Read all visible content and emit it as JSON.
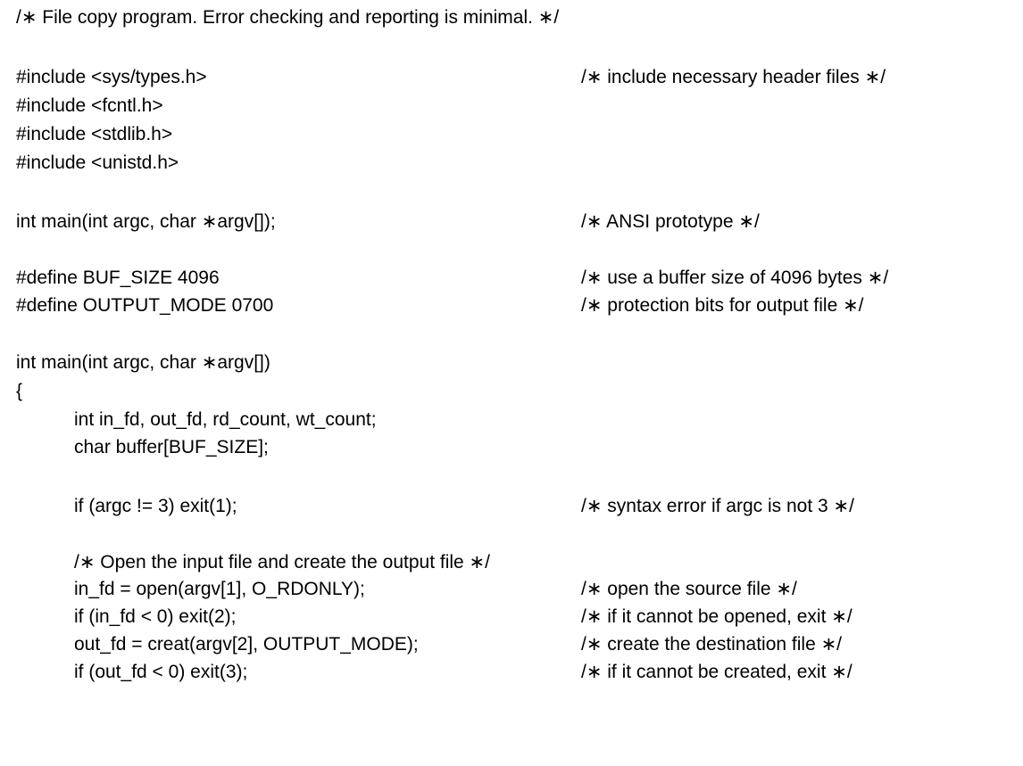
{
  "header_comment": "/∗ File copy program. Error checking and reporting is minimal. ∗/",
  "lines": [
    {
      "code": "#include <sys/types.h>",
      "comment": "/∗ include necessary header files ∗/"
    },
    {
      "code": "#include <fcntl.h>",
      "comment": ""
    },
    {
      "code": "#include <stdlib.h>",
      "comment": ""
    },
    {
      "code": "#include <unistd.h>",
      "comment": ""
    },
    {
      "code": "int main(int argc, char ∗argv[]);",
      "comment": "/∗ ANSI prototype ∗/"
    },
    {
      "code": "#define BUF_SIZE 4096",
      "comment": "/∗ use a buffer size of 4096 bytes ∗/"
    },
    {
      "code": "#define OUTPUT_MODE 0700",
      "comment": "/∗ protection bits for output file ∗/"
    },
    {
      "code": "int main(int argc, char ∗argv[])",
      "comment": ""
    },
    {
      "code": "{",
      "comment": ""
    },
    {
      "code": "int in_fd, out_fd, rd_count, wt_count;",
      "comment": ""
    },
    {
      "code": "char buffer[BUF_SIZE];",
      "comment": ""
    },
    {
      "code": "if (argc != 3) exit(1);",
      "comment": "/∗ syntax error if argc is not 3 ∗/"
    },
    {
      "code": "/∗ Open the input file and create the output file ∗/",
      "comment": ""
    },
    {
      "code": "in_fd = open(argv[1], O_RDONLY);",
      "comment": "/∗ open the source file ∗/"
    },
    {
      "code": "if (in_fd < 0) exit(2);",
      "comment": "/∗ if it cannot be opened, exit ∗/"
    },
    {
      "code": "out_fd = creat(argv[2], OUTPUT_MODE);",
      "comment": "/∗ create the destination file ∗/"
    },
    {
      "code": "if (out_fd < 0) exit(3);",
      "comment": "/∗ if it cannot be created, exit ∗/"
    }
  ]
}
